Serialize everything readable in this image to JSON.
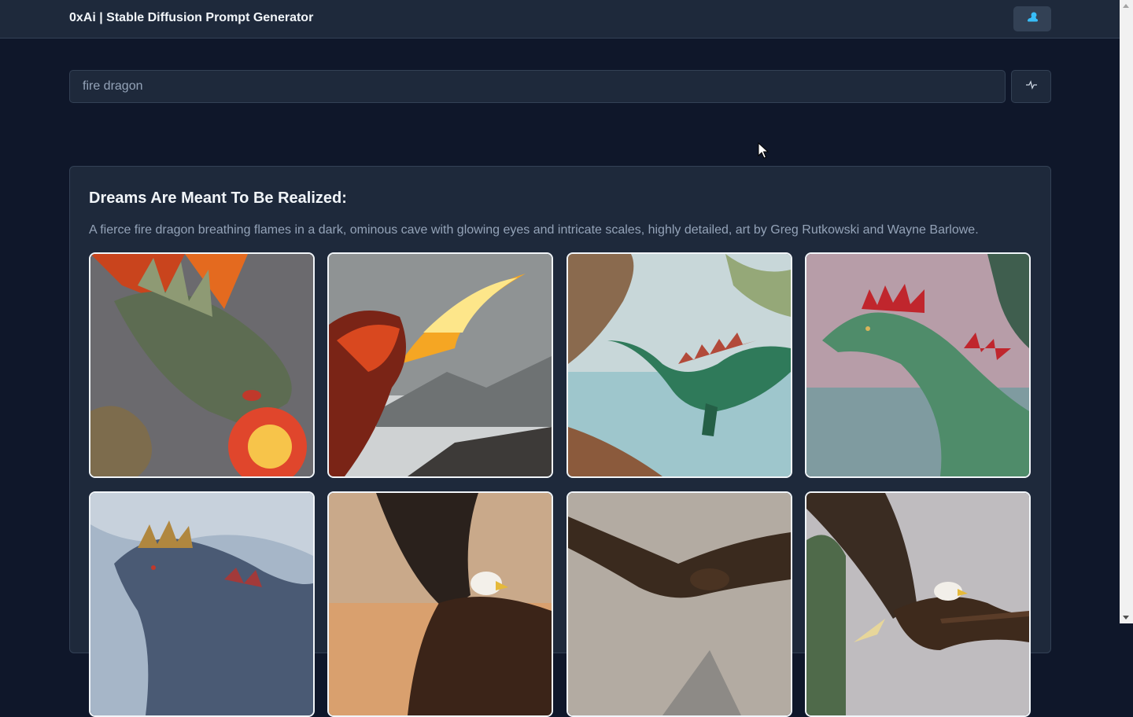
{
  "header": {
    "title": "0xAi | Stable Diffusion Prompt Generator",
    "theme_icon": "cloud-sun-icon"
  },
  "search": {
    "value": "fire dragon",
    "generate_icon": "activity-icon"
  },
  "result": {
    "heading": "Dreams Are Meant To Be Realized:",
    "prompt": "A fierce fire dragon breathing flames in a dark, ominous cave with glowing eyes and intricate scales, highly detailed, art by Greg Rutkowski and Wayne Barlowe."
  },
  "gallery": [
    {
      "subject": "dragon head breathing fire"
    },
    {
      "subject": "dragon breathing flames over mountains"
    },
    {
      "subject": "green dragon wading in misty lake"
    },
    {
      "subject": "green serpent dragon in water"
    },
    {
      "subject": "grey dragon with red spikes"
    },
    {
      "subject": "bald eagle with raised wing"
    },
    {
      "subject": "eagle in flight"
    },
    {
      "subject": "bald eagle landing on branch"
    }
  ],
  "colors": {
    "page_bg": "#0f172a",
    "panel_bg": "#1e293b",
    "border": "#334155",
    "accent": "#38bdf8"
  }
}
